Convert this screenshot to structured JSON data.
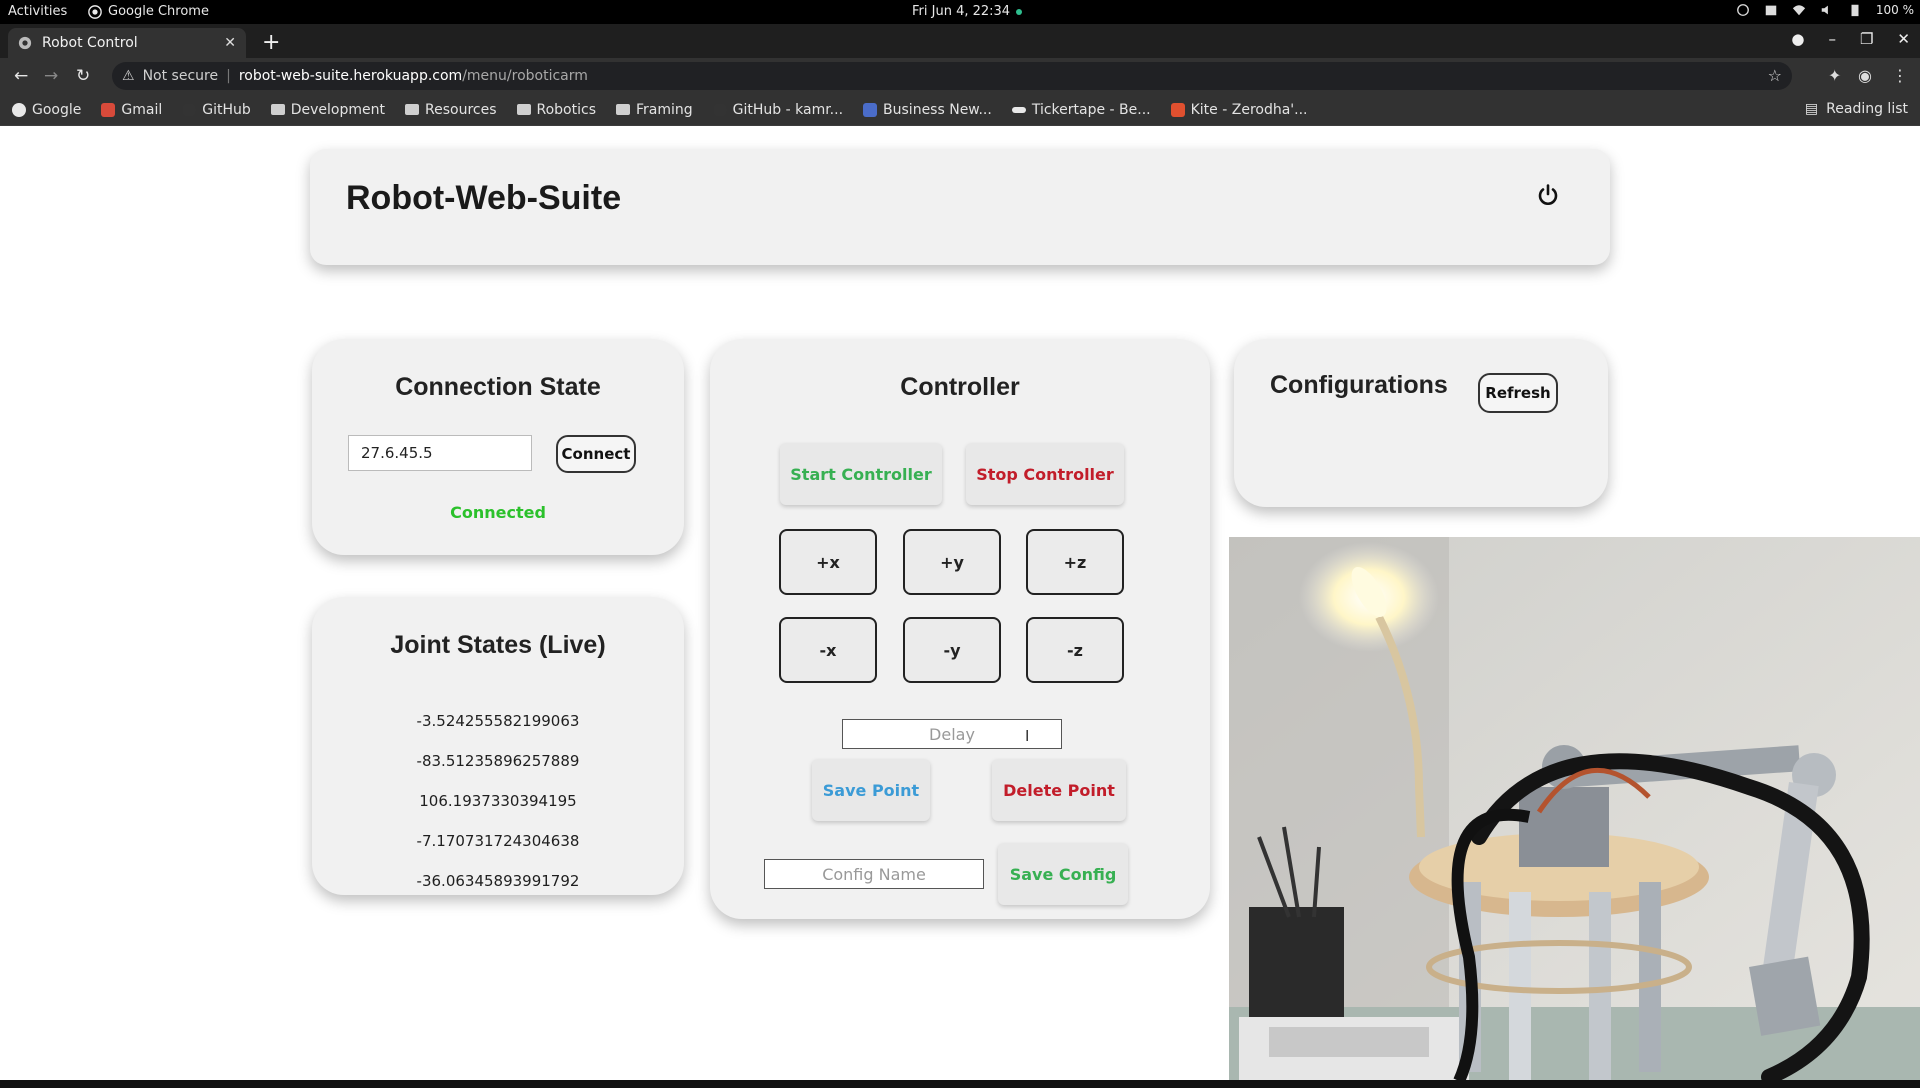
{
  "os": {
    "activities": "Activities",
    "app_name": "Google Chrome",
    "clock": "Fri Jun 4, 22:34",
    "battery": "100 %"
  },
  "browser": {
    "tab_title": "Robot Control",
    "security_label": "Not secure",
    "url_host": "robot-web-suite.herokuapp.com",
    "url_path": "/menu/roboticarm",
    "bookmarks": [
      {
        "label": "Google",
        "icon": "google-icon"
      },
      {
        "label": "Gmail",
        "icon": "gmail-icon"
      },
      {
        "label": "GitHub",
        "icon": "github-icon"
      },
      {
        "label": "Development",
        "icon": "folder-icon"
      },
      {
        "label": "Resources",
        "icon": "folder-icon"
      },
      {
        "label": "Robotics",
        "icon": "folder-icon"
      },
      {
        "label": "Framing",
        "icon": "folder-icon"
      },
      {
        "label": "GitHub - kamr...",
        "icon": "github-icon"
      },
      {
        "label": "Business New...",
        "icon": "news-icon"
      },
      {
        "label": "Tickertape - Be...",
        "icon": "tickertape-icon"
      },
      {
        "label": "Kite - Zerodha'...",
        "icon": "kite-icon"
      }
    ],
    "reading_list": "Reading list"
  },
  "app": {
    "title": "Robot-Web-Suite",
    "connection": {
      "title": "Connection State",
      "ip_value": "27.6.45.5",
      "connect_label": "Connect",
      "status": "Connected"
    },
    "joints": {
      "title": "Joint States (Live)",
      "values": [
        "-3.524255582199063",
        "-83.51235896257889",
        "106.1937330394195",
        "-7.170731724304638",
        "-36.06345893991792"
      ]
    },
    "controller": {
      "title": "Controller",
      "start_label": "Start Controller",
      "stop_label": "Stop Controller",
      "axis": {
        "px": "+x",
        "py": "+y",
        "pz": "+z",
        "nx": "-x",
        "ny": "-y",
        "nz": "-z"
      },
      "delay_placeholder": "Delay",
      "save_point_label": "Save Point",
      "delete_point_label": "Delete Point",
      "config_name_placeholder": "Config Name",
      "save_config_label": "Save Config"
    },
    "configurations": {
      "title": "Configurations",
      "refresh_label": "Refresh"
    }
  },
  "colors": {
    "accent_green": "#37b052",
    "accent_red": "#c21d2a",
    "accent_blue": "#3b9bd6",
    "status_connected": "#2bc12b",
    "card_bg": "#f1f1f1"
  }
}
